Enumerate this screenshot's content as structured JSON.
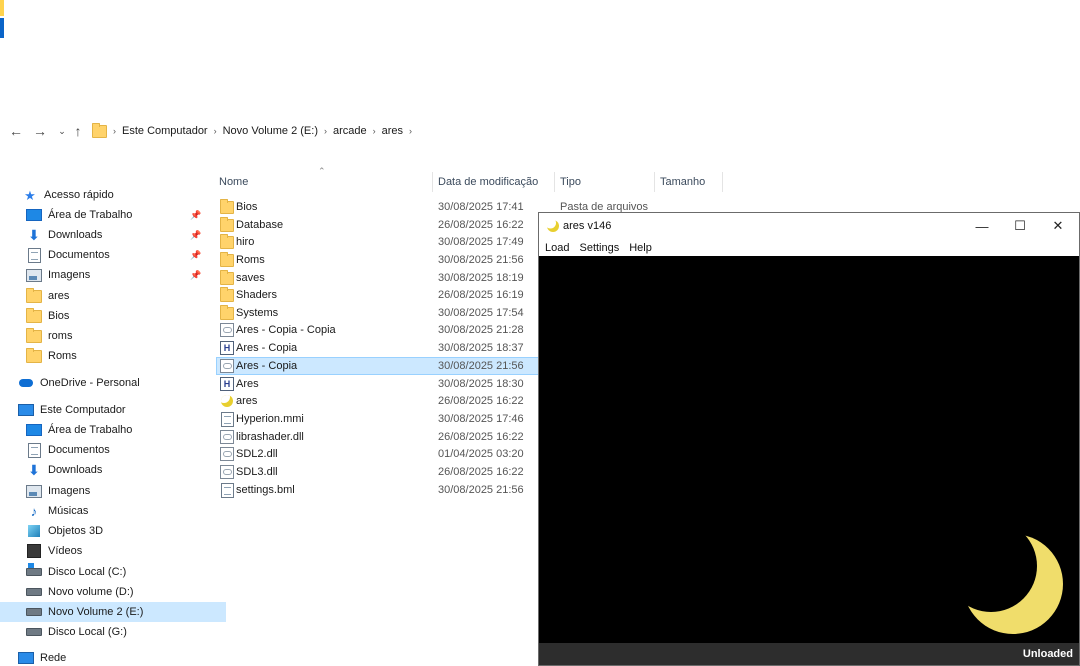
{
  "explorer": {
    "breadcrumb": [
      "Este Computador",
      "Novo Volume 2 (E:)",
      "arcade",
      "ares"
    ],
    "sidebar": {
      "quick_access": "Acesso rápido",
      "quick_items": [
        {
          "label": "Área de Trabalho",
          "icon": "desktop-icon",
          "pinned": true
        },
        {
          "label": "Downloads",
          "icon": "download-icon",
          "pinned": true
        },
        {
          "label": "Documentos",
          "icon": "documents-icon",
          "pinned": true
        },
        {
          "label": "Imagens",
          "icon": "pictures-icon",
          "pinned": true
        },
        {
          "label": "ares",
          "icon": "folder-icon",
          "pinned": false
        },
        {
          "label": "Bios",
          "icon": "folder-icon",
          "pinned": false
        },
        {
          "label": "roms",
          "icon": "folder-icon",
          "pinned": false
        },
        {
          "label": "Roms",
          "icon": "folder-icon",
          "pinned": false
        }
      ],
      "onedrive": "OneDrive - Personal",
      "this_pc": "Este Computador",
      "pc_items": [
        {
          "label": "Área de Trabalho",
          "icon": "desktop-icon"
        },
        {
          "label": "Documentos",
          "icon": "documents-icon"
        },
        {
          "label": "Downloads",
          "icon": "download-icon"
        },
        {
          "label": "Imagens",
          "icon": "pictures-icon"
        },
        {
          "label": "Músicas",
          "icon": "music-icon"
        },
        {
          "label": "Objetos 3D",
          "icon": "objects-3d-icon"
        },
        {
          "label": "Vídeos",
          "icon": "videos-icon"
        },
        {
          "label": "Disco Local (C:)",
          "icon": "system-drive-icon"
        },
        {
          "label": "Novo volume (D:)",
          "icon": "drive-icon"
        },
        {
          "label": "Novo Volume 2 (E:)",
          "icon": "drive-icon",
          "selected": true
        },
        {
          "label": "Disco Local (G:)",
          "icon": "drive-icon"
        }
      ],
      "network": "Rede"
    },
    "columns": {
      "name": "Nome",
      "date": "Data de modificação",
      "type": "Tipo",
      "size": "Tamanho"
    },
    "files": [
      {
        "name": "Bios",
        "date": "30/08/2025 17:41",
        "type": "Pasta de arquivos",
        "icon": "folder-icon"
      },
      {
        "name": "Database",
        "date": "26/08/2025 16:22",
        "type": "",
        "icon": "folder-icon"
      },
      {
        "name": "hiro",
        "date": "30/08/2025 17:49",
        "type": "",
        "icon": "folder-icon"
      },
      {
        "name": "Roms",
        "date": "30/08/2025 21:56",
        "type": "",
        "icon": "folder-icon"
      },
      {
        "name": "saves",
        "date": "30/08/2025 18:19",
        "type": "",
        "icon": "folder-icon"
      },
      {
        "name": "Shaders",
        "date": "26/08/2025 16:19",
        "type": "",
        "icon": "folder-icon"
      },
      {
        "name": "Systems",
        "date": "30/08/2025 17:54",
        "type": "",
        "icon": "folder-icon"
      },
      {
        "name": "Ares - Copia - Copia",
        "date": "30/08/2025 21:28",
        "type": "",
        "icon": "config-file-icon"
      },
      {
        "name": "Ares - Copia",
        "date": "30/08/2025 18:37",
        "type": "",
        "icon": "executable-icon"
      },
      {
        "name": "Ares - Copia",
        "date": "30/08/2025 21:56",
        "type": "",
        "icon": "config-file-icon",
        "selected": true
      },
      {
        "name": "Ares",
        "date": "30/08/2025 18:30",
        "type": "",
        "icon": "executable-icon"
      },
      {
        "name": "ares",
        "date": "26/08/2025 16:22",
        "type": "",
        "icon": "ares-moon-icon"
      },
      {
        "name": "Hyperion.mmi",
        "date": "30/08/2025 17:46",
        "type": "",
        "icon": "file-icon"
      },
      {
        "name": "librashader.dll",
        "date": "26/08/2025 16:22",
        "type": "",
        "icon": "dll-icon"
      },
      {
        "name": "SDL2.dll",
        "date": "01/04/2025 03:20",
        "type": "",
        "icon": "dll-icon"
      },
      {
        "name": "SDL3.dll",
        "date": "26/08/2025 16:22",
        "type": "",
        "icon": "dll-icon"
      },
      {
        "name": "settings.bml",
        "date": "30/08/2025 21:56",
        "type": "",
        "icon": "file-icon"
      }
    ]
  },
  "ares_window": {
    "title": "ares v146",
    "menu": [
      "Load",
      "Settings",
      "Help"
    ],
    "status": "Unloaded",
    "controls": {
      "minimize": "—",
      "maximize": "☐",
      "close": "✕"
    },
    "moon_color": "#f0dd6b"
  }
}
